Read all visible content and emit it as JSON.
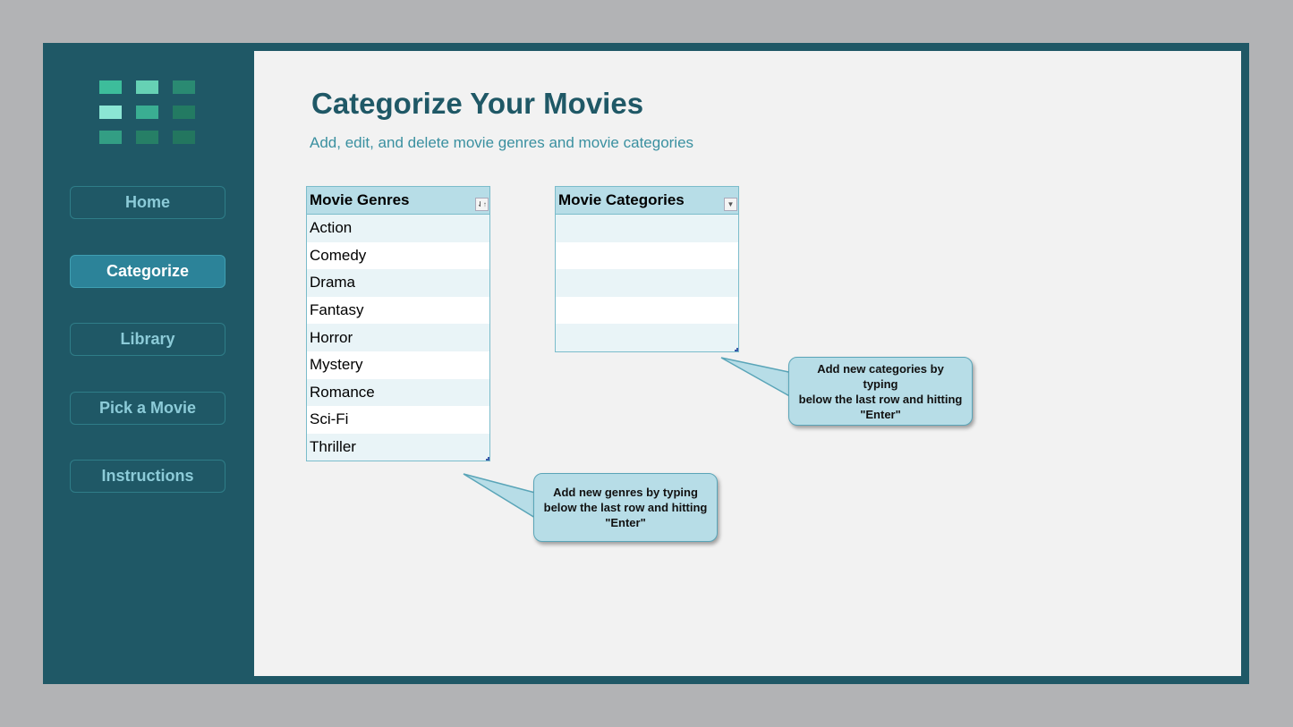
{
  "sidebar": {
    "logo_colors": [
      [
        "#3dbd9b",
        "#66d1b4",
        "#2a8a72"
      ],
      [
        "#8be6d4",
        "#3aae92",
        "#237a62"
      ],
      [
        "#339e84",
        "#267f66",
        "#23765f"
      ]
    ],
    "nav": [
      {
        "label": "Home",
        "active": false
      },
      {
        "label": "Categorize",
        "active": true
      },
      {
        "label": "Library",
        "active": false
      },
      {
        "label": "Pick a Movie",
        "active": false
      },
      {
        "label": "Instructions",
        "active": false
      }
    ]
  },
  "main": {
    "title": "Categorize Your Movies",
    "subtitle": "Add, edit, and delete movie genres and movie categories",
    "genres_table": {
      "header": "Movie Genres",
      "filter_icon": "sort-ascending-icon",
      "rows": [
        "Action",
        "Comedy",
        "Drama",
        "Fantasy",
        "Horror",
        "Mystery",
        "Romance",
        "Sci-Fi",
        "Thriller"
      ]
    },
    "categories_table": {
      "header": "Movie Categories",
      "filter_icon": "dropdown-arrow-icon",
      "rows": [
        "",
        "",
        "",
        "",
        ""
      ]
    },
    "callouts": {
      "genres": {
        "line1": "Add new genres by typing",
        "line2": "below the last row and hitting",
        "line3": "\"Enter\""
      },
      "categories": {
        "line1": "Add new categories by typing",
        "line2": "below the last row and hitting",
        "line3": "\"Enter\""
      }
    }
  }
}
